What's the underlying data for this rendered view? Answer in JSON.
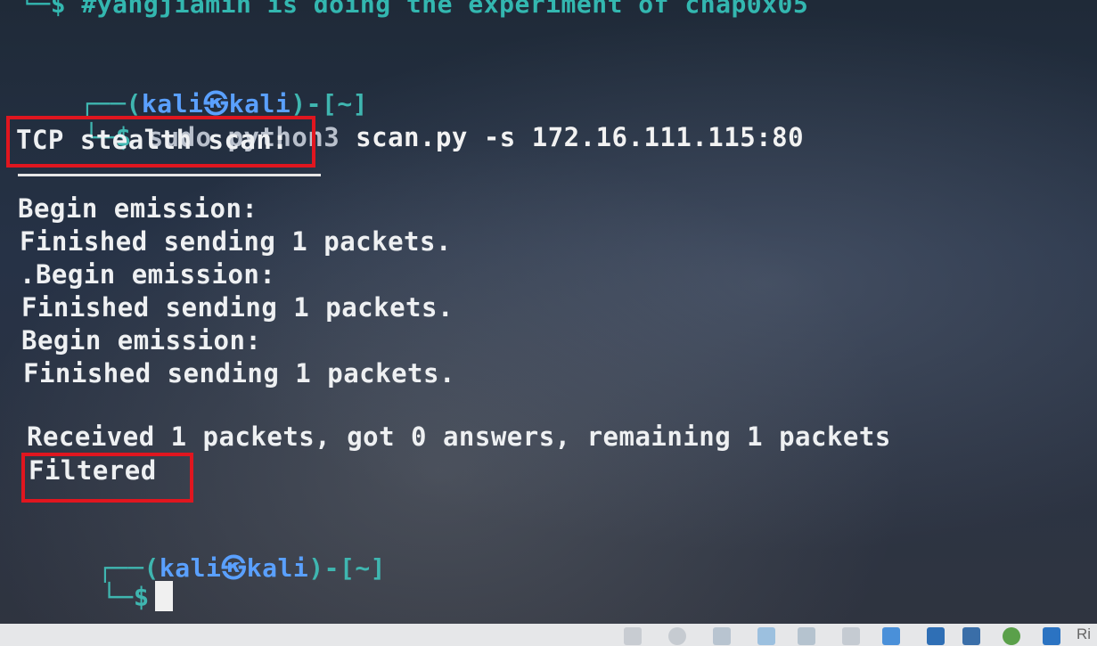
{
  "terminal": {
    "comment_line": "└─$ #yangjiamin is doing the experiment of chap0x05",
    "prompt1": {
      "corner": "┌──(",
      "user_host": "kali㉿kali",
      "tail": ")-[~]",
      "dollar_line": "└─$ ",
      "command_dim": "sudo python3 ",
      "command_script": "scan.py",
      "command_args": " -s 172.16.111.115:80"
    },
    "scan_title": "TCP stealth scan:",
    "output": [
      "Begin emission:",
      "Finished sending 1 packets.",
      ".Begin emission:",
      "Finished sending 1 packets.",
      "Begin emission:",
      "Finished sending 1 packets."
    ],
    "received": "Received 1 packets, got 0 answers, remaining 1 packets",
    "result": "Filtered",
    "prompt2": {
      "corner": "┌──(",
      "user_host": "kali㉿kali",
      "tail": ")-[~]",
      "dollar_line": "└─$"
    }
  },
  "highlight_color": "#e0161f",
  "taskbar": {
    "tray_label": "Ri"
  }
}
